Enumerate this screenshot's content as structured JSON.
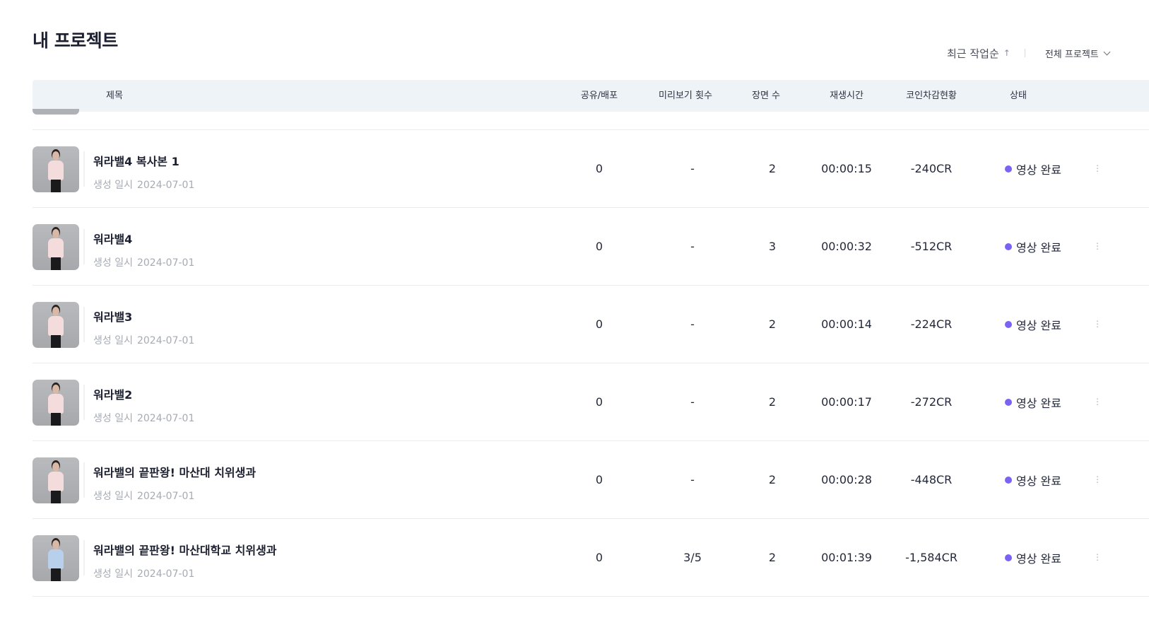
{
  "page": {
    "title": "내 프로젝트"
  },
  "controls": {
    "sort_label": "최근 작업순",
    "sort_arrow": "↑",
    "filter_label": "전체 프로젝트"
  },
  "table": {
    "columns": {
      "title": "제목",
      "share": "공유/배포",
      "preview": "미리보기 횟수",
      "scenes": "장면 수",
      "duration": "재생시간",
      "coin": "코인차감현황",
      "status": "상태"
    },
    "meta_label": "생성 일시",
    "more_glyph": "⋮",
    "status_color": "#7a63f2",
    "rows": [
      {
        "title": "워라밸4 복사본 1",
        "date": "2024-07-01",
        "share": "0",
        "preview": "-",
        "scenes": "2",
        "duration": "00:00:15",
        "coin": "-240CR",
        "status": "영상 완료",
        "shirt": "pink"
      },
      {
        "title": "워라밸4",
        "date": "2024-07-01",
        "share": "0",
        "preview": "-",
        "scenes": "3",
        "duration": "00:00:32",
        "coin": "-512CR",
        "status": "영상 완료",
        "shirt": "pink"
      },
      {
        "title": "워라밸3",
        "date": "2024-07-01",
        "share": "0",
        "preview": "-",
        "scenes": "2",
        "duration": "00:00:14",
        "coin": "-224CR",
        "status": "영상 완료",
        "shirt": "pink"
      },
      {
        "title": "워라밸2",
        "date": "2024-07-01",
        "share": "0",
        "preview": "-",
        "scenes": "2",
        "duration": "00:00:17",
        "coin": "-272CR",
        "status": "영상 완료",
        "shirt": "pink"
      },
      {
        "title": "워라밸의 끝판왕! 마산대 치위생과",
        "date": "2024-07-01",
        "share": "0",
        "preview": "-",
        "scenes": "2",
        "duration": "00:00:28",
        "coin": "-448CR",
        "status": "영상 완료",
        "shirt": "pink"
      },
      {
        "title": "워라밸의 끝판왕! 마산대학교 치위생과",
        "date": "2024-07-01",
        "share": "0",
        "preview": "3/5",
        "scenes": "2",
        "duration": "00:01:39",
        "coin": "-1,584CR",
        "status": "영상 완료",
        "shirt": "blue"
      }
    ]
  }
}
